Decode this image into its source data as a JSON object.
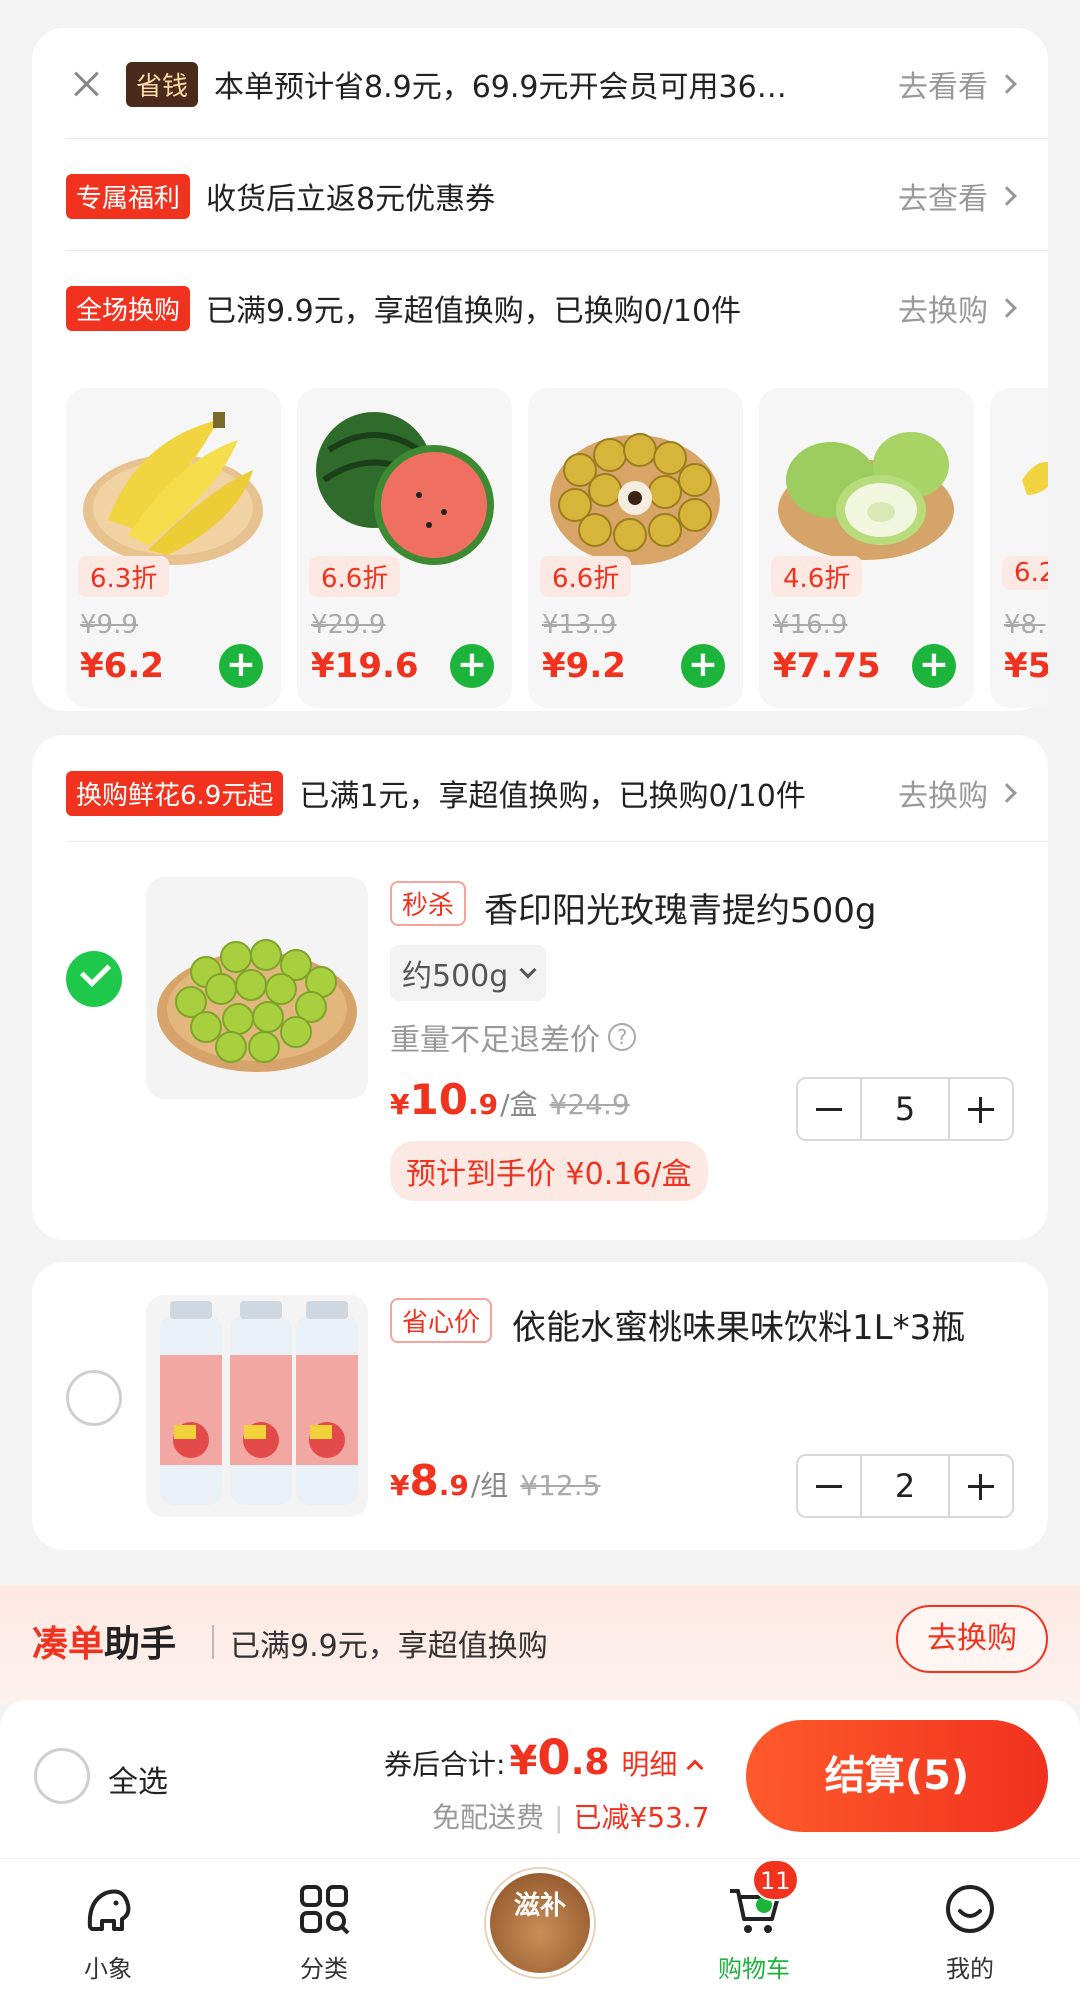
{
  "promo": {
    "save_tag": "省钱",
    "save_text": "本单预计省8.9元，69.9元开会员可用36…",
    "save_link": "去看看",
    "benefit_tag": "专属福利",
    "benefit_text": "收货后立返8元优惠券",
    "benefit_link": "去查看",
    "swap_tag": "全场换购",
    "swap_text": "已满9.9元，享超值换购，已换购0/10件",
    "swap_link": "去换购",
    "swap_items": [
      {
        "name": "banana",
        "discount": "6.3折",
        "orig": "¥9.9",
        "price": "¥6.2"
      },
      {
        "name": "watermelon",
        "discount": "6.6折",
        "orig": "¥29.9",
        "price": "¥19.6"
      },
      {
        "name": "longan",
        "discount": "6.6折",
        "orig": "¥13.9",
        "price": "¥9.2"
      },
      {
        "name": "guava",
        "discount": "4.6折",
        "orig": "¥16.9",
        "price": "¥7.75"
      },
      {
        "name": "partial",
        "discount": "6.2",
        "orig": "¥8.",
        "price": "¥5"
      }
    ]
  },
  "cart": {
    "flower_tag": "换购鲜花6.9元起",
    "flower_text": "已满1元，享超值换购，已换购0/10件",
    "flower_link": "去换购",
    "items": [
      {
        "tag": "秒杀",
        "title": "香印阳光玫瑰青提约500g",
        "spec": "约500g",
        "note": "重量不足退差价",
        "price_yen": "¥",
        "price_int": "10",
        "price_dec": ".9",
        "unit": "/盒",
        "orig": "¥24.9",
        "qty": "5",
        "est": "预计到手价 ¥0.16/盒",
        "checked": true
      },
      {
        "tag": "省心价",
        "title": "依能水蜜桃味果味饮料1L*3瓶",
        "price_yen": "¥",
        "price_int": "8",
        "price_dec": ".9",
        "unit": "/组",
        "orig": "¥12.5",
        "qty": "2",
        "checked": false
      }
    ]
  },
  "helper": {
    "brand_a": "凑单",
    "brand_b": "助手",
    "text": "已满9.9元，享超值换购",
    "button": "去换购"
  },
  "checkout": {
    "select_all": "全选",
    "total_label": "券后合计:",
    "yen": "¥",
    "amount_int": "0",
    "amount_dec": ".8",
    "detail": "明细",
    "free_ship": "免配送费",
    "reduced": "已减¥53.7",
    "button": "结算(5)"
  },
  "tabbar": {
    "tabs": [
      {
        "label": "小象",
        "icon": "elephant-icon"
      },
      {
        "label": "分类",
        "icon": "category-icon"
      },
      {
        "label": "滋补",
        "icon": "tonic-promo-icon"
      },
      {
        "label": "购物车",
        "icon": "cart-icon"
      },
      {
        "label": "我的",
        "icon": "profile-icon"
      }
    ],
    "cart_badge": "11",
    "active_color": "#1db43c"
  },
  "colors": {
    "accent_red": "#f0321e",
    "green": "#1db43c"
  }
}
